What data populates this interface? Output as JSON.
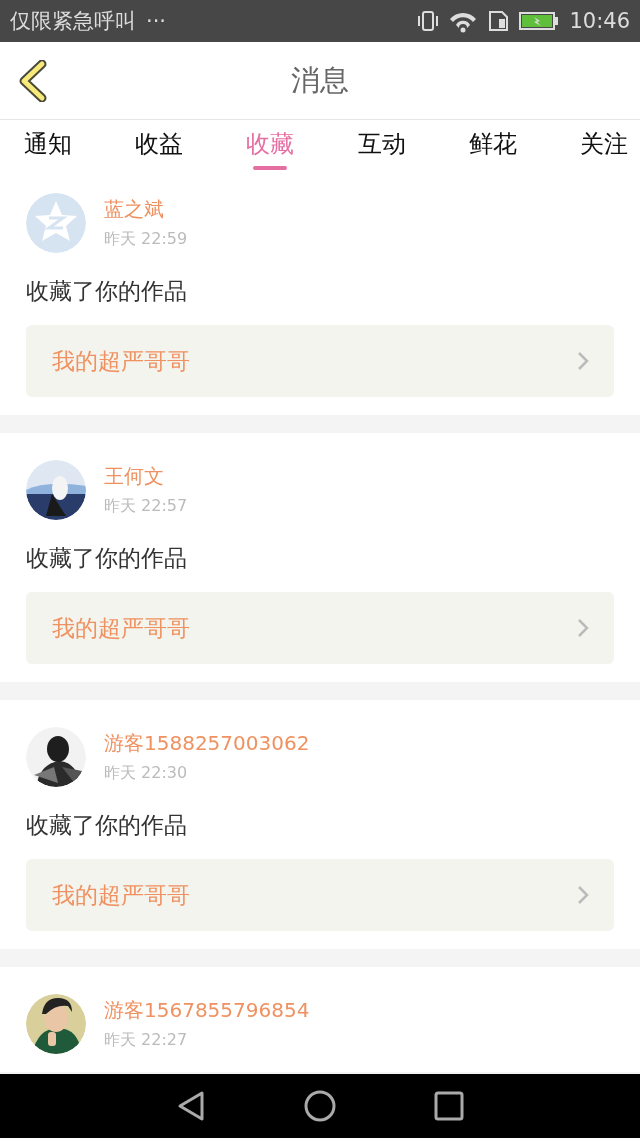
{
  "status_bar": {
    "carrier": "仅限紧急呼叫",
    "more": "···",
    "time": "10:46"
  },
  "header": {
    "title": "消息"
  },
  "tabs": [
    {
      "label": "通知",
      "selected": false
    },
    {
      "label": "收益",
      "selected": false
    },
    {
      "label": "收藏",
      "selected": true
    },
    {
      "label": "互动",
      "selected": false
    },
    {
      "label": "鲜花",
      "selected": false
    },
    {
      "label": "关注",
      "selected": false
    }
  ],
  "messages": [
    {
      "avatar": {
        "kind": "default"
      },
      "name": "蓝之斌",
      "time": "昨天 22:59",
      "text": "收藏了你的作品",
      "work": "我的超严哥哥"
    },
    {
      "name": "王何文",
      "time": "昨天 22:57",
      "text": "收藏了你的作品",
      "work": "我的超严哥哥"
    },
    {
      "name": "游客1588257003062",
      "time": "昨天 22:30",
      "text": "收藏了你的作品",
      "work": "我的超严哥哥"
    },
    {
      "name": "游客1567855796854",
      "time": "昨天 22:27"
    }
  ]
}
